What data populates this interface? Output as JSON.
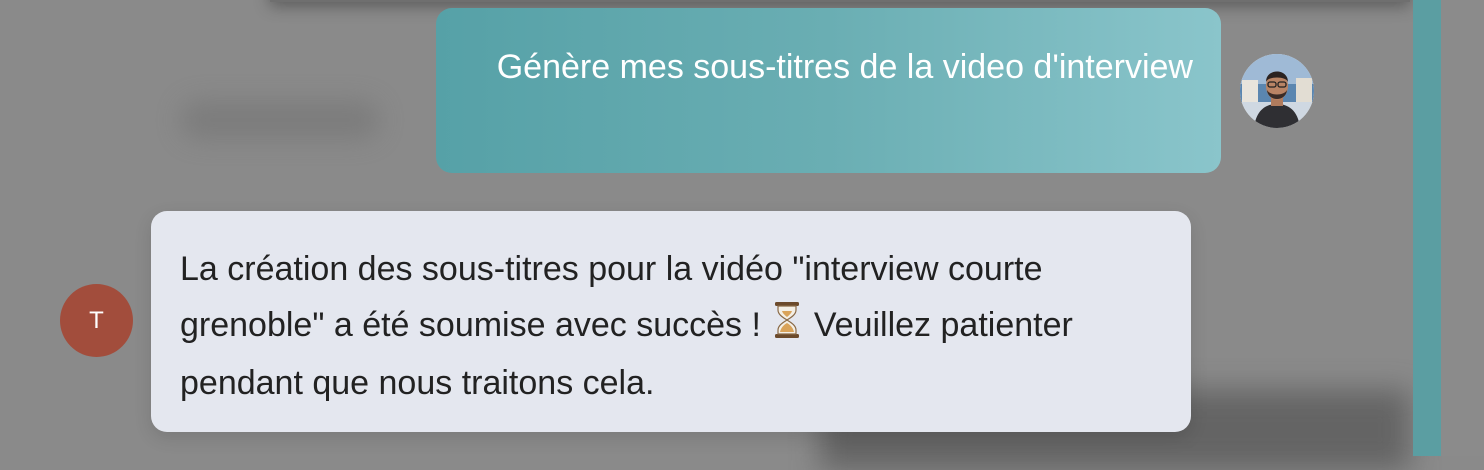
{
  "chat": {
    "user_message": {
      "text": "Génère mes sous-titres de la video d'interview"
    },
    "assistant_message": {
      "avatar_initial": "T",
      "text_part1": "La création des sous-titres pour la vidéo \"interview courte grenoble\" a été soumise avec succès !",
      "icon": "hourglass-icon",
      "text_part2": "Veuillez patienter pendant que nous traitons cela."
    }
  },
  "colors": {
    "background": "#8a8a8a",
    "user_bubble_gradient_start": "#56a1a7",
    "user_bubble_gradient_end": "#8ac5cb",
    "assistant_bubble": "#e4e7ef",
    "assistant_avatar": "#a24d3c",
    "accent_rail": "#5b9ea2"
  }
}
